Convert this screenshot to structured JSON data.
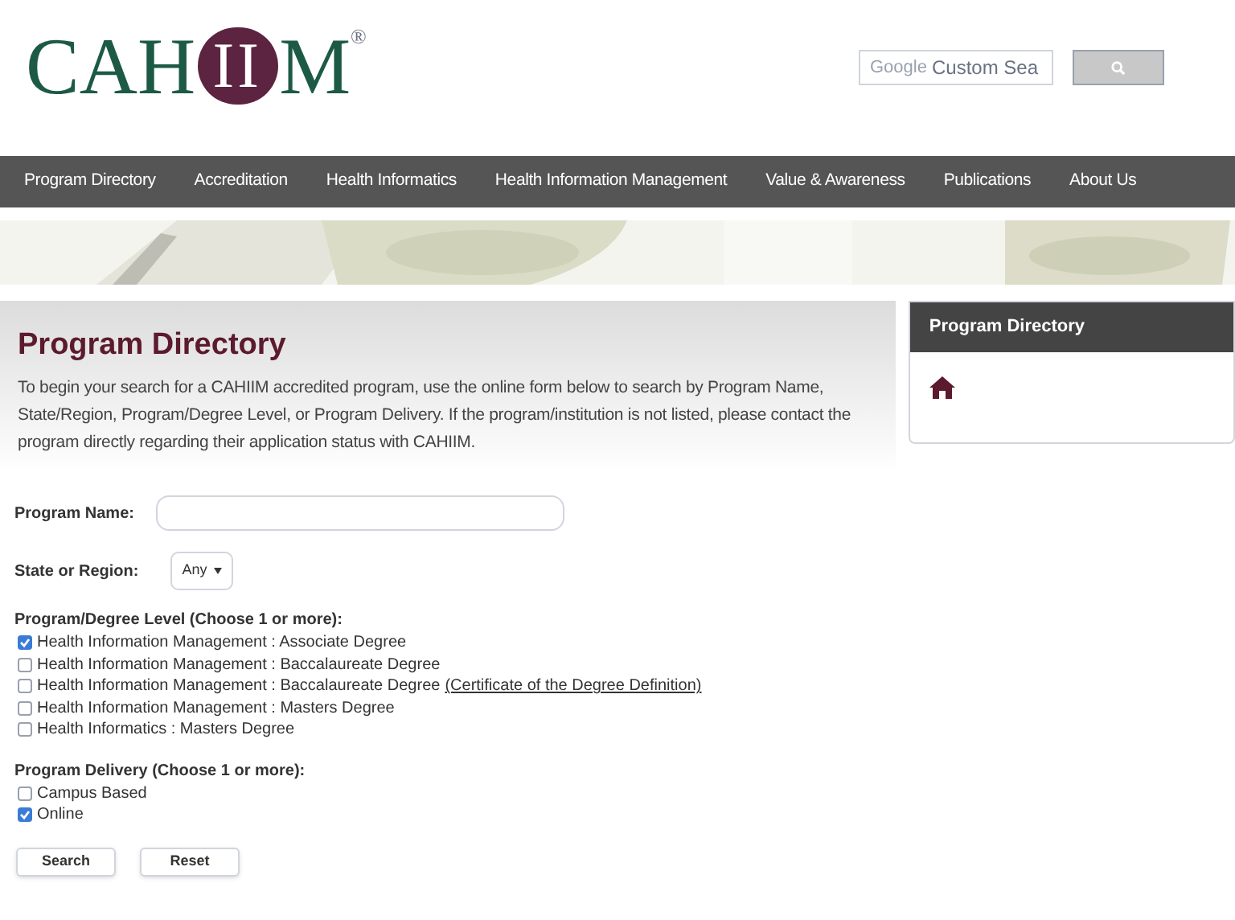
{
  "logo": {
    "prefix": "CAH",
    "mark": "II",
    "suffix": "M",
    "registered": "®"
  },
  "search": {
    "placeholder_brand": "Google",
    "placeholder": "Custom Sea"
  },
  "nav": [
    {
      "label": "Program Directory"
    },
    {
      "label": "Accreditation"
    },
    {
      "label": "Health Informatics"
    },
    {
      "label": "Health Information Management"
    },
    {
      "label": "Value & Awareness"
    },
    {
      "label": "Publications"
    },
    {
      "label": "About Us"
    }
  ],
  "intro": {
    "title": "Program Directory",
    "text": "To begin your search for a CAHIIM accredited program, use the online form below to search by Program Name, State/Region, Program/Degree Level, or Program Delivery. If the program/institution is not listed, please contact the program directly regarding their application status with CAHIIM."
  },
  "sidebar": {
    "title": "Program Directory"
  },
  "form": {
    "program_name_label": "Program Name:",
    "state_label": "State or Region:",
    "state_value": "Any",
    "degree_heading": "Program/Degree Level (Choose 1 or more):",
    "degrees": [
      {
        "label": "Health Information Management : Associate Degree",
        "checked": true
      },
      {
        "label": "Health Information Management : Baccalaureate Degree",
        "checked": false
      },
      {
        "label": "Health Information Management : Baccalaureate Degree",
        "link": "(Certificate of the Degree Definition)",
        "checked": false
      },
      {
        "label": "Health Information Management : Masters Degree",
        "checked": false
      },
      {
        "label": "Health Informatics : Masters Degree",
        "checked": false
      }
    ],
    "delivery_heading": "Program Delivery (Choose 1 or more):",
    "delivery": [
      {
        "label": "Campus Based",
        "checked": false
      },
      {
        "label": "Online",
        "checked": true
      }
    ],
    "buttons": [
      "Search",
      "Reset"
    ]
  }
}
